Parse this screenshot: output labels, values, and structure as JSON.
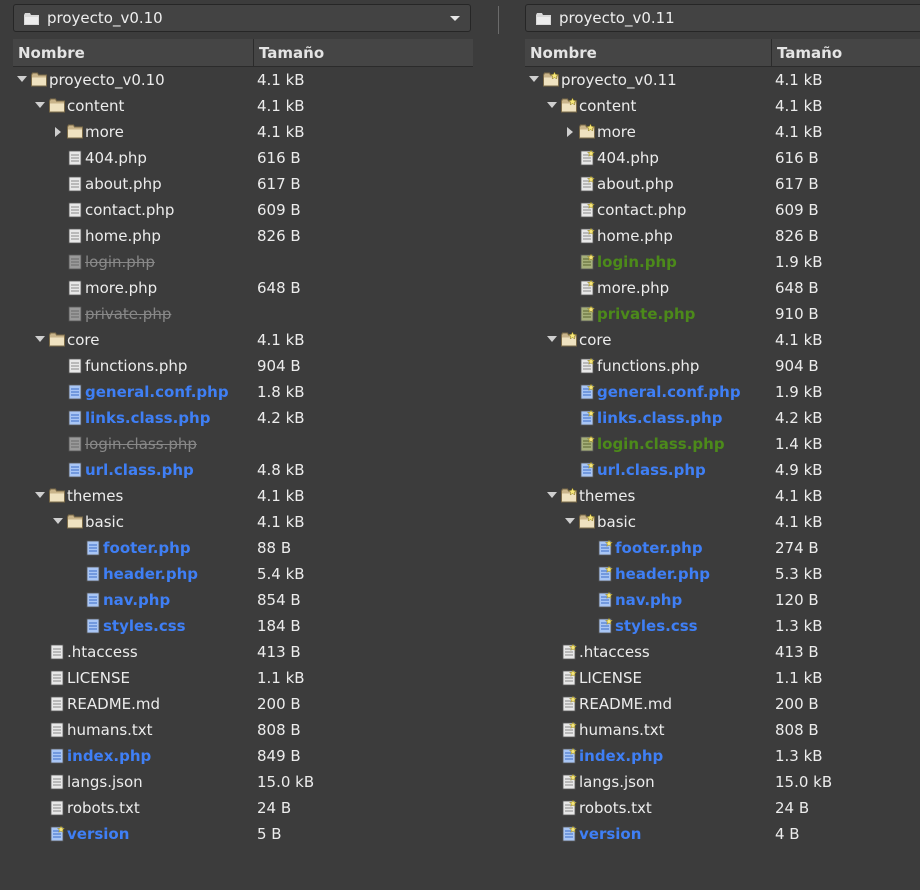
{
  "left": {
    "folder": "proyecto_v0.10",
    "columns": {
      "name": "Nombre",
      "size": "Tamaño"
    },
    "rows": [
      {
        "name": "proyecto_v0.10",
        "size": "4.1 kB",
        "depth": 0,
        "type": "folder",
        "expander": "open",
        "state": "normal"
      },
      {
        "name": "content",
        "size": "4.1 kB",
        "depth": 1,
        "type": "folder",
        "expander": "open",
        "state": "normal"
      },
      {
        "name": "more",
        "size": "4.1 kB",
        "depth": 2,
        "type": "folder",
        "expander": "closed",
        "state": "normal"
      },
      {
        "name": "404.php",
        "size": "616 B",
        "depth": 2,
        "type": "file",
        "state": "normal"
      },
      {
        "name": "about.php",
        "size": "617 B",
        "depth": 2,
        "type": "file",
        "state": "normal"
      },
      {
        "name": "contact.php",
        "size": "609 B",
        "depth": 2,
        "type": "file",
        "state": "normal"
      },
      {
        "name": "home.php",
        "size": "826 B",
        "depth": 2,
        "type": "file",
        "state": "normal"
      },
      {
        "name": "login.php",
        "size": "",
        "depth": 2,
        "type": "file",
        "state": "missing"
      },
      {
        "name": "more.php",
        "size": "648 B",
        "depth": 2,
        "type": "file",
        "state": "normal"
      },
      {
        "name": "private.php",
        "size": "",
        "depth": 2,
        "type": "file",
        "state": "missing"
      },
      {
        "name": "core",
        "size": "4.1 kB",
        "depth": 1,
        "type": "folder",
        "expander": "open",
        "state": "normal"
      },
      {
        "name": "functions.php",
        "size": "904 B",
        "depth": 2,
        "type": "file",
        "state": "normal"
      },
      {
        "name": "general.conf.php",
        "size": "1.8 kB",
        "depth": 2,
        "type": "file",
        "state": "modified"
      },
      {
        "name": "links.class.php",
        "size": "4.2 kB",
        "depth": 2,
        "type": "file",
        "state": "modified"
      },
      {
        "name": "login.class.php",
        "size": "",
        "depth": 2,
        "type": "file",
        "state": "missing"
      },
      {
        "name": "url.class.php",
        "size": "4.8 kB",
        "depth": 2,
        "type": "file",
        "state": "modified"
      },
      {
        "name": "themes",
        "size": "4.1 kB",
        "depth": 1,
        "type": "folder",
        "expander": "open",
        "state": "normal"
      },
      {
        "name": "basic",
        "size": "4.1 kB",
        "depth": 2,
        "type": "folder",
        "expander": "open",
        "state": "normal"
      },
      {
        "name": "footer.php",
        "size": "88 B",
        "depth": 3,
        "type": "file",
        "state": "modified"
      },
      {
        "name": "header.php",
        "size": "5.4 kB",
        "depth": 3,
        "type": "file",
        "state": "modified"
      },
      {
        "name": "nav.php",
        "size": "854 B",
        "depth": 3,
        "type": "file",
        "state": "modified"
      },
      {
        "name": "styles.css",
        "size": "184 B",
        "depth": 3,
        "type": "file",
        "state": "modified"
      },
      {
        "name": ".htaccess",
        "size": "413 B",
        "depth": 1,
        "type": "file",
        "state": "normal"
      },
      {
        "name": "LICENSE",
        "size": "1.1 kB",
        "depth": 1,
        "type": "file",
        "state": "normal"
      },
      {
        "name": "README.md",
        "size": "200 B",
        "depth": 1,
        "type": "file",
        "state": "normal"
      },
      {
        "name": "humans.txt",
        "size": "808 B",
        "depth": 1,
        "type": "file",
        "state": "normal"
      },
      {
        "name": "index.php",
        "size": "849 B",
        "depth": 1,
        "type": "file",
        "state": "modified"
      },
      {
        "name": "langs.json",
        "size": "15.0 kB",
        "depth": 1,
        "type": "file",
        "state": "normal"
      },
      {
        "name": "robots.txt",
        "size": "24 B",
        "depth": 1,
        "type": "file",
        "state": "normal"
      },
      {
        "name": "version",
        "size": "5 B",
        "depth": 1,
        "type": "file",
        "state": "modified",
        "star": true
      }
    ]
  },
  "right": {
    "folder": "proyecto_v0.11",
    "columns": {
      "name": "Nombre",
      "size": "Tamaño"
    },
    "rows": [
      {
        "name": "proyecto_v0.11",
        "size": "4.1 kB",
        "depth": 0,
        "type": "folder",
        "expander": "open",
        "state": "normal",
        "star": true
      },
      {
        "name": "content",
        "size": "4.1 kB",
        "depth": 1,
        "type": "folder",
        "expander": "open",
        "state": "normal",
        "star": true
      },
      {
        "name": "more",
        "size": "4.1 kB",
        "depth": 2,
        "type": "folder",
        "expander": "closed",
        "state": "normal",
        "star": true
      },
      {
        "name": "404.php",
        "size": "616 B",
        "depth": 2,
        "type": "file",
        "state": "normal",
        "star": true
      },
      {
        "name": "about.php",
        "size": "617 B",
        "depth": 2,
        "type": "file",
        "state": "normal",
        "star": true
      },
      {
        "name": "contact.php",
        "size": "609 B",
        "depth": 2,
        "type": "file",
        "state": "normal",
        "star": true
      },
      {
        "name": "home.php",
        "size": "826 B",
        "depth": 2,
        "type": "file",
        "state": "normal",
        "star": true
      },
      {
        "name": "login.php",
        "size": "1.9 kB",
        "depth": 2,
        "type": "file",
        "state": "added",
        "star": true
      },
      {
        "name": "more.php",
        "size": "648 B",
        "depth": 2,
        "type": "file",
        "state": "normal",
        "star": true
      },
      {
        "name": "private.php",
        "size": "910 B",
        "depth": 2,
        "type": "file",
        "state": "added",
        "star": true
      },
      {
        "name": "core",
        "size": "4.1 kB",
        "depth": 1,
        "type": "folder",
        "expander": "open",
        "state": "normal",
        "star": true
      },
      {
        "name": "functions.php",
        "size": "904 B",
        "depth": 2,
        "type": "file",
        "state": "normal",
        "star": true
      },
      {
        "name": "general.conf.php",
        "size": "1.9 kB",
        "depth": 2,
        "type": "file",
        "state": "modified",
        "star": true
      },
      {
        "name": "links.class.php",
        "size": "4.2 kB",
        "depth": 2,
        "type": "file",
        "state": "modified",
        "star": true
      },
      {
        "name": "login.class.php",
        "size": "1.4 kB",
        "depth": 2,
        "type": "file",
        "state": "added",
        "star": true
      },
      {
        "name": "url.class.php",
        "size": "4.9 kB",
        "depth": 2,
        "type": "file",
        "state": "modified",
        "star": true
      },
      {
        "name": "themes",
        "size": "4.1 kB",
        "depth": 1,
        "type": "folder",
        "expander": "open",
        "state": "normal",
        "star": true
      },
      {
        "name": "basic",
        "size": "4.1 kB",
        "depth": 2,
        "type": "folder",
        "expander": "open",
        "state": "normal",
        "star": true
      },
      {
        "name": "footer.php",
        "size": "274 B",
        "depth": 3,
        "type": "file",
        "state": "modified",
        "star": true
      },
      {
        "name": "header.php",
        "size": "5.3 kB",
        "depth": 3,
        "type": "file",
        "state": "modified",
        "star": true
      },
      {
        "name": "nav.php",
        "size": "120 B",
        "depth": 3,
        "type": "file",
        "state": "modified",
        "star": true
      },
      {
        "name": "styles.css",
        "size": "1.3 kB",
        "depth": 3,
        "type": "file",
        "state": "modified",
        "star": true
      },
      {
        "name": ".htaccess",
        "size": "413 B",
        "depth": 1,
        "type": "file",
        "state": "normal",
        "star": true
      },
      {
        "name": "LICENSE",
        "size": "1.1 kB",
        "depth": 1,
        "type": "file",
        "state": "normal",
        "star": true
      },
      {
        "name": "README.md",
        "size": "200 B",
        "depth": 1,
        "type": "file",
        "state": "normal",
        "star": true
      },
      {
        "name": "humans.txt",
        "size": "808 B",
        "depth": 1,
        "type": "file",
        "state": "normal",
        "star": true
      },
      {
        "name": "index.php",
        "size": "1.3 kB",
        "depth": 1,
        "type": "file",
        "state": "modified",
        "star": true
      },
      {
        "name": "langs.json",
        "size": "15.0 kB",
        "depth": 1,
        "type": "file",
        "state": "normal",
        "star": true
      },
      {
        "name": "robots.txt",
        "size": "24 B",
        "depth": 1,
        "type": "file",
        "state": "normal",
        "star": true
      },
      {
        "name": "version",
        "size": "4 B",
        "depth": 1,
        "type": "file",
        "state": "modified",
        "star": true
      }
    ]
  },
  "colors": {
    "background": "#3c3c3c",
    "modified": "#3f7ff5",
    "added": "#4c8a1a",
    "missing": "#888888"
  }
}
